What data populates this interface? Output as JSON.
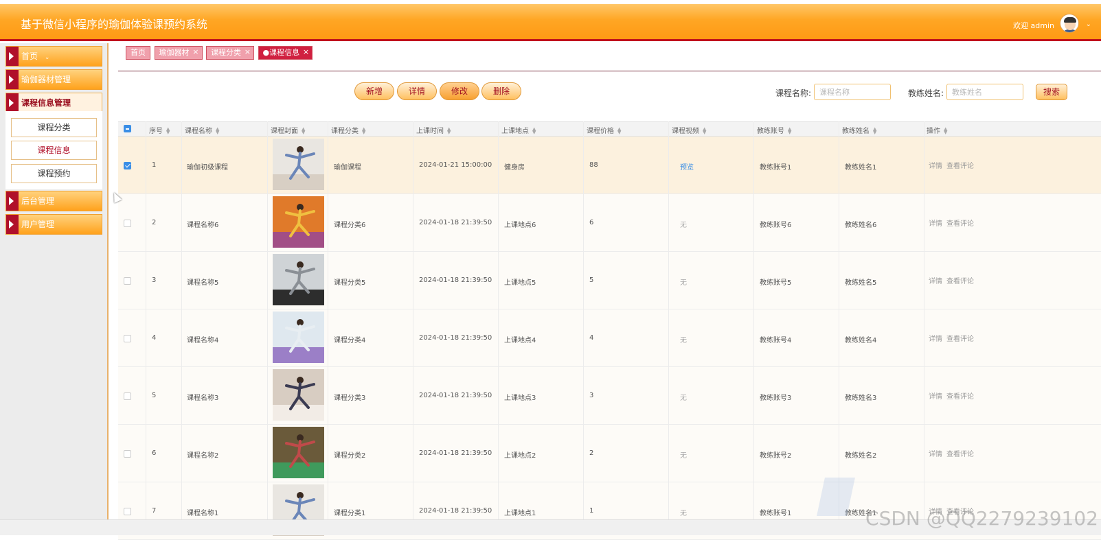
{
  "header": {
    "title": "基于微信小程序的瑜伽体验课预约系统",
    "welcome": "欢迎 admin"
  },
  "sidebar": {
    "items": [
      {
        "label": "首页"
      },
      {
        "label": "瑜伽器材管理"
      },
      {
        "label": "课程信息管理"
      },
      {
        "label": "后台管理"
      },
      {
        "label": "用户管理"
      }
    ],
    "submenu": [
      {
        "label": "课程分类"
      },
      {
        "label": "课程信息"
      },
      {
        "label": "课程预约"
      }
    ]
  },
  "tabs": [
    {
      "label": "首页"
    },
    {
      "label": "瑜伽器材"
    },
    {
      "label": "课程分类"
    },
    {
      "label": "●课程信息"
    }
  ],
  "toolbar": {
    "add": "新增",
    "detail": "详情",
    "edit": "修改",
    "delete": "删除",
    "course_name_label": "课程名称:",
    "course_name_placeholder": "课程名称",
    "coach_name_label": "教练姓名:",
    "coach_name_placeholder": "教练姓名",
    "search": "搜索"
  },
  "table": {
    "columns": [
      "序号",
      "课程名称",
      "课程封面",
      "课程分类",
      "上课时间",
      "上课地点",
      "课程价格",
      "课程视频",
      "教练账号",
      "教练姓名",
      "操作"
    ],
    "rows": [
      {
        "no": "1",
        "name": "瑜伽初级课程",
        "category": "瑜伽课程",
        "time": "2024-01-21 15:00:00",
        "place": "健身房",
        "price": "88",
        "video": "预览",
        "account": "教练账号1",
        "coach": "教练姓名1",
        "selected": true
      },
      {
        "no": "2",
        "name": "课程名称6",
        "category": "课程分类6",
        "time": "2024-01-18 21:39:50",
        "place": "上课地点6",
        "price": "6",
        "video": "无",
        "account": "教练账号6",
        "coach": "教练姓名6",
        "selected": false
      },
      {
        "no": "3",
        "name": "课程名称5",
        "category": "课程分类5",
        "time": "2024-01-18 21:39:50",
        "place": "上课地点5",
        "price": "5",
        "video": "无",
        "account": "教练账号5",
        "coach": "教练姓名5",
        "selected": false
      },
      {
        "no": "4",
        "name": "课程名称4",
        "category": "课程分类4",
        "time": "2024-01-18 21:39:50",
        "place": "上课地点4",
        "price": "4",
        "video": "无",
        "account": "教练账号4",
        "coach": "教练姓名4",
        "selected": false
      },
      {
        "no": "5",
        "name": "课程名称3",
        "category": "课程分类3",
        "time": "2024-01-18 21:39:50",
        "place": "上课地点3",
        "price": "3",
        "video": "无",
        "account": "教练账号3",
        "coach": "教练姓名3",
        "selected": false
      },
      {
        "no": "6",
        "name": "课程名称2",
        "category": "课程分类2",
        "time": "2024-01-18 21:39:50",
        "place": "上课地点2",
        "price": "2",
        "video": "无",
        "account": "教练账号2",
        "coach": "教练姓名2",
        "selected": false
      },
      {
        "no": "7",
        "name": "课程名称1",
        "category": "课程分类1",
        "time": "2024-01-18 21:39:50",
        "place": "上课地点1",
        "price": "1",
        "video": "无",
        "account": "教练账号1",
        "coach": "教练姓名1",
        "selected": false
      }
    ],
    "op_detail": "详情",
    "op_comments": "查看评论"
  },
  "watermark": "CSDN @QQ2279239102",
  "colors": {
    "brand_orange": "#ffa624",
    "accent_red": "#b0102a",
    "link_blue": "#3a8ee6"
  }
}
